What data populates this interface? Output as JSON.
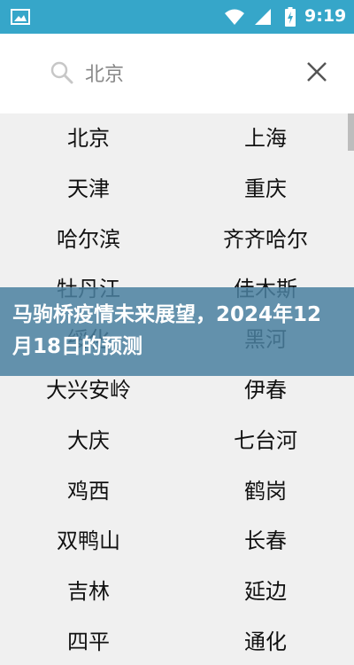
{
  "status_bar": {
    "time": "9:19",
    "icons": [
      "image-icon",
      "wifi-icon",
      "signal-icon",
      "battery-icon"
    ],
    "background": "#36a6c9"
  },
  "search": {
    "value": "北京",
    "search_icon": "search-icon",
    "clear_icon": "close-icon"
  },
  "cities": [
    [
      "北京",
      "上海"
    ],
    [
      "天津",
      "重庆"
    ],
    [
      "哈尔滨",
      "齐齐哈尔"
    ],
    [
      "牡丹江",
      "佳木斯"
    ],
    [
      "绥化",
      "黑河"
    ],
    [
      "大兴安岭",
      "伊春"
    ],
    [
      "大庆",
      "七台河"
    ],
    [
      "鸡西",
      "鹤岗"
    ],
    [
      "双鸭山",
      "长春"
    ],
    [
      "吉林",
      "延边"
    ],
    [
      "四平",
      "通化"
    ]
  ],
  "banner": {
    "title": "马驹桥疫情未来展望，2024年12月18日的预测"
  }
}
